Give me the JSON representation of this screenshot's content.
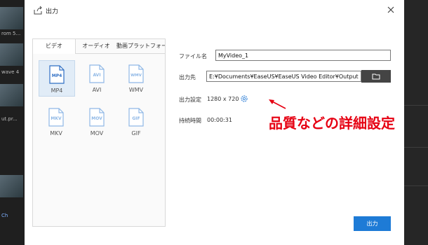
{
  "background": {
    "thumb_labels": [
      "rom 5...",
      "wave 4",
      "ut.pr...",
      "",
      "Ch"
    ]
  },
  "dialog": {
    "title": "出力",
    "icons": {
      "title": "export-icon",
      "close": "close-icon",
      "folder": "folder-icon",
      "settings": "gear-icon"
    }
  },
  "tabs": [
    {
      "label": "ビデオ",
      "active": true
    },
    {
      "label": "オーディオ",
      "active": false
    },
    {
      "label": "動画プラットフォーム",
      "active": false
    }
  ],
  "formats": [
    {
      "badge": "MP4",
      "label": "MP4",
      "selected": true
    },
    {
      "badge": "AVI",
      "label": "AVI",
      "selected": false
    },
    {
      "badge": "WMV",
      "label": "WMV",
      "selected": false
    },
    {
      "badge": "MKV",
      "label": "MKV",
      "selected": false
    },
    {
      "badge": "MOV",
      "label": "MOV",
      "selected": false
    },
    {
      "badge": "GIF",
      "label": "GIF",
      "selected": false
    }
  ],
  "form": {
    "filename_label": "ファイル名",
    "filename_value": "MyVideo_1",
    "destination_label": "出力先",
    "destination_value": "E:¥Documents¥EaseUS¥EaseUS Video Editor¥Output",
    "settings_label": "出力設定",
    "settings_value": "1280 x 720",
    "duration_label": "持続時間",
    "duration_value": "00:00:31"
  },
  "annotation": {
    "text": "品質などの詳細設定",
    "color": "#e60012"
  },
  "export_button": "出力",
  "colors": {
    "accent": "#1e7bd6",
    "selected_bg": "#e1ecf7"
  }
}
